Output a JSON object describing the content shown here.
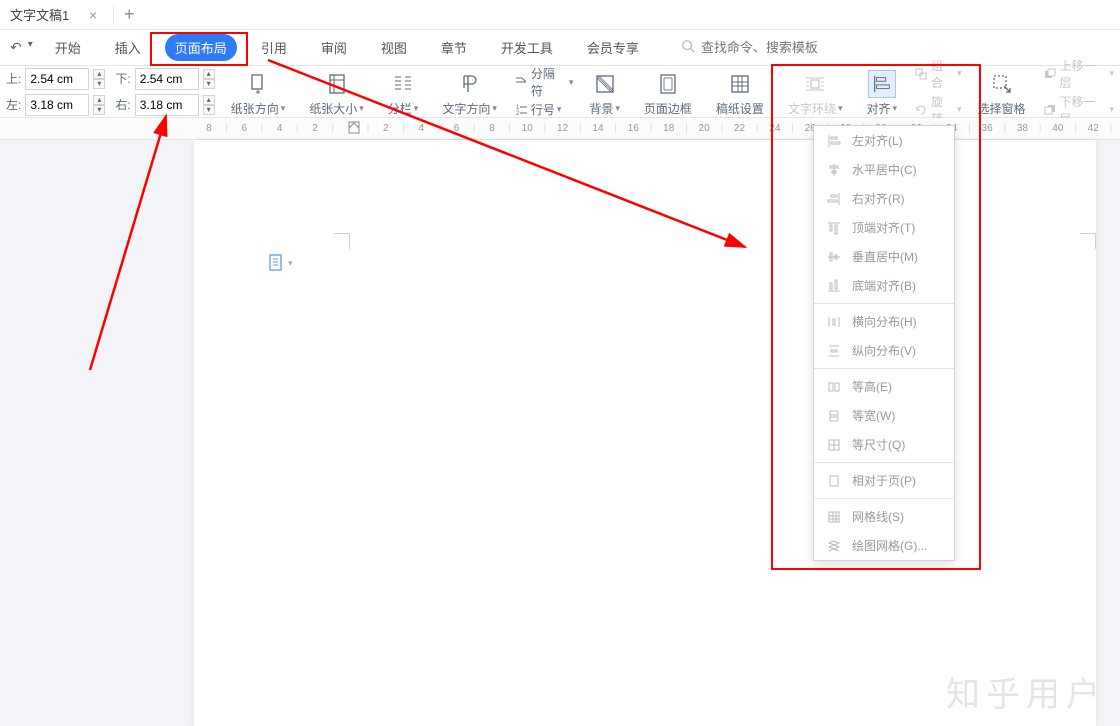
{
  "title_tab": "文字文稿1",
  "menu": {
    "tabs": [
      "开始",
      "插入",
      "页面布局",
      "引用",
      "审阅",
      "视图",
      "章节",
      "开发工具",
      "会员专享"
    ],
    "active_index": 2,
    "search_placeholder": "查找命令、搜索模板"
  },
  "margins": {
    "top_lbl": "上:",
    "top_val": "2.54 cm",
    "bottom_lbl": "下:",
    "bottom_val": "2.54 cm",
    "left_lbl": "左:",
    "left_val": "3.18 cm",
    "right_lbl": "右:",
    "right_val": "3.18 cm"
  },
  "ribbon": {
    "page_orient": "纸张方向",
    "page_size": "纸张大小",
    "columns": "分栏",
    "text_dir": "文字方向",
    "breaks": "分隔符",
    "line_num": "行号",
    "background": "背景",
    "page_border": "页面边框",
    "manuscript": "稿纸设置",
    "text_wrap": "文字环绕",
    "align": "对齐",
    "group": "组合",
    "rotate": "旋转",
    "select_pane": "选择窗格",
    "up_layer": "上移一层",
    "down_layer": "下移一层"
  },
  "ruler_ticks": [
    "8",
    "6",
    "4",
    "2",
    "",
    "2",
    "4",
    "6",
    "8",
    "10",
    "12",
    "14",
    "16",
    "18",
    "20",
    "22",
    "24",
    "26",
    "28",
    "30",
    "32",
    "34",
    "36",
    "38",
    "40",
    "42"
  ],
  "align_menu": [
    {
      "label": "左对齐(L)",
      "icon": "align-left"
    },
    {
      "label": "水平居中(C)",
      "icon": "align-hcenter"
    },
    {
      "label": "右对齐(R)",
      "icon": "align-right"
    },
    {
      "label": "顶端对齐(T)",
      "icon": "align-top"
    },
    {
      "label": "垂直居中(M)",
      "icon": "align-vcenter"
    },
    {
      "label": "底端对齐(B)",
      "icon": "align-bottom"
    },
    "sep",
    {
      "label": "横向分布(H)",
      "icon": "distribute-h"
    },
    {
      "label": "纵向分布(V)",
      "icon": "distribute-v"
    },
    "sep",
    {
      "label": "等高(E)",
      "icon": "equal-h"
    },
    {
      "label": "等宽(W)",
      "icon": "equal-w"
    },
    {
      "label": "等尺寸(Q)",
      "icon": "equal-size"
    },
    "sep",
    {
      "label": "相对于页(P)",
      "icon": "relative-page"
    },
    "sep",
    {
      "label": "网格线(S)",
      "icon": "grid"
    },
    {
      "label": "绘图网格(G)...",
      "icon": "draw-grid"
    }
  ],
  "watermark": "知乎用户"
}
